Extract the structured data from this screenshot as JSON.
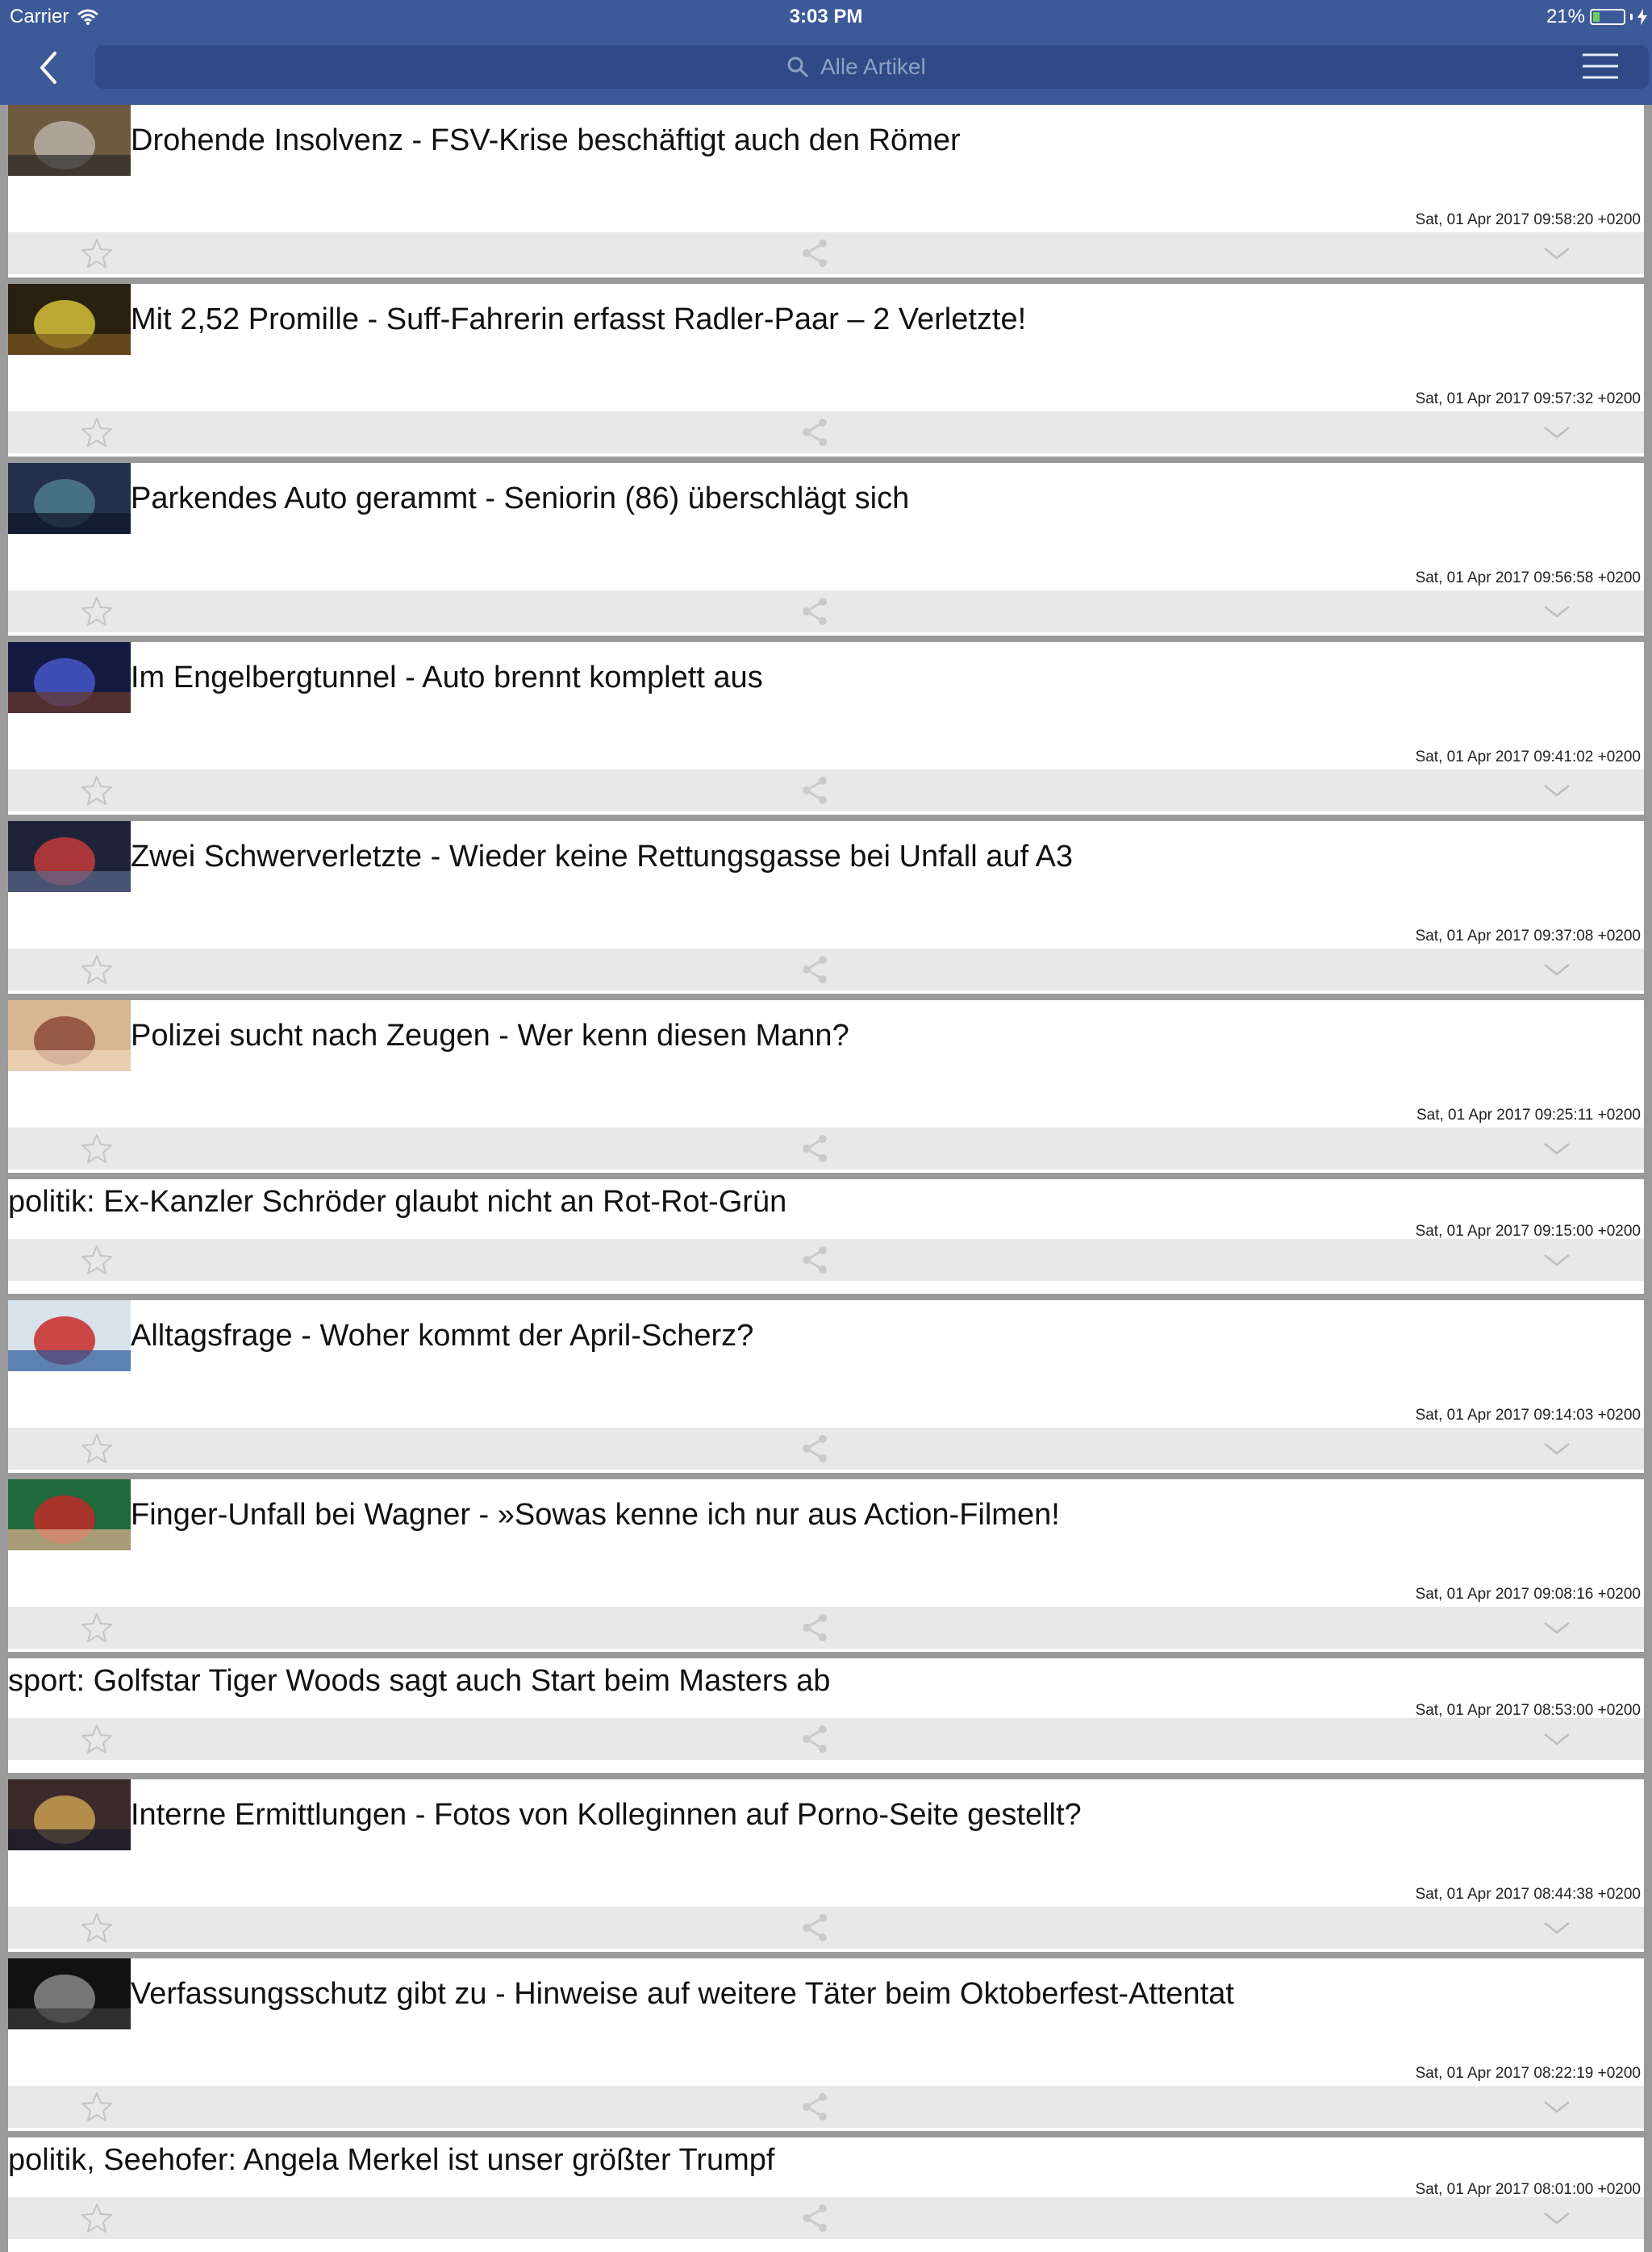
{
  "status_bar": {
    "carrier": "Carrier",
    "time": "3:03 PM",
    "battery_percent": "21%",
    "battery_level": 0.21
  },
  "search": {
    "placeholder": "Alle Artikel"
  },
  "icons": {
    "back": "chevron-left-icon",
    "search": "search-icon",
    "menu": "hamburger-menu-icon",
    "favorite": "star-outline-icon",
    "share": "share-icon",
    "expand": "chevron-down-icon",
    "wifi": "wifi-icon",
    "battery": "battery-icon",
    "charging": "bolt-icon"
  },
  "colors": {
    "nav_bar": "#3d5a98",
    "search_field": "#2f4a86",
    "card": "#ffffff",
    "action_bar": "#e8e8e8",
    "separator": "#9a9a9a",
    "battery_fill": "#6ad05b"
  },
  "articles": [
    {
      "title": "Drohende Insolvenz - FSV-Krise beschäftigt auch den Römer",
      "date": "Sat, 01 Apr 2017 09:58:20 +0200",
      "has_image": true
    },
    {
      "title": "Mit 2,52 Promille - Suff-Fahrerin erfasst Radler-Paar – 2 Verletzte!",
      "date": "Sat, 01 Apr 2017 09:57:32 +0200",
      "has_image": true
    },
    {
      "title": "Parkendes Auto gerammt - Seniorin (86) überschlägt sich",
      "date": "Sat, 01 Apr 2017 09:56:58 +0200",
      "has_image": true
    },
    {
      "title": "Im Engelbergtunnel - Auto brennt komplett aus",
      "date": "Sat, 01 Apr 2017 09:41:02 +0200",
      "has_image": true
    },
    {
      "title": "Zwei Schwerverletzte - Wieder keine Rettungsgasse bei Unfall auf A3",
      "date": "Sat, 01 Apr 2017 09:37:08 +0200",
      "has_image": true
    },
    {
      "title": "Polizei sucht nach Zeugen - Wer kenn diesen Mann?",
      "date": "Sat, 01 Apr 2017 09:25:11 +0200",
      "has_image": true
    },
    {
      "title": "politik: Ex-Kanzler Schröder glaubt nicht an Rot-Rot-Grün",
      "date": "Sat, 01 Apr 2017 09:15:00 +0200",
      "has_image": false
    },
    {
      "title": "Alltagsfrage - Woher kommt der April-Scherz?",
      "date": "Sat, 01 Apr 2017 09:14:03 +0200",
      "has_image": true
    },
    {
      "title": "Finger-Unfall bei Wagner - »Sowas kenne ich nur aus Action-Filmen!",
      "date": "Sat, 01 Apr 2017 09:08:16 +0200",
      "has_image": true
    },
    {
      "title": "sport: Golfstar Tiger Woods sagt auch Start beim Masters ab",
      "date": "Sat, 01 Apr 2017 08:53:00 +0200",
      "has_image": false
    },
    {
      "title": "Interne Ermittlungen - Fotos von Kolleginnen auf Porno-Seite gestellt?",
      "date": "Sat, 01 Apr 2017 08:44:38 +0200",
      "has_image": true
    },
    {
      "title": "Verfassungsschutz gibt zu - Hinweise auf weitere Täter beim Oktoberfest-Attentat",
      "date": "Sat, 01 Apr 2017 08:22:19 +0200",
      "has_image": true
    },
    {
      "title": "politik, Seehofer: Angela Merkel ist unser größter Trumpf",
      "date": "Sat, 01 Apr 2017 08:01:00 +0200",
      "has_image": false
    }
  ]
}
